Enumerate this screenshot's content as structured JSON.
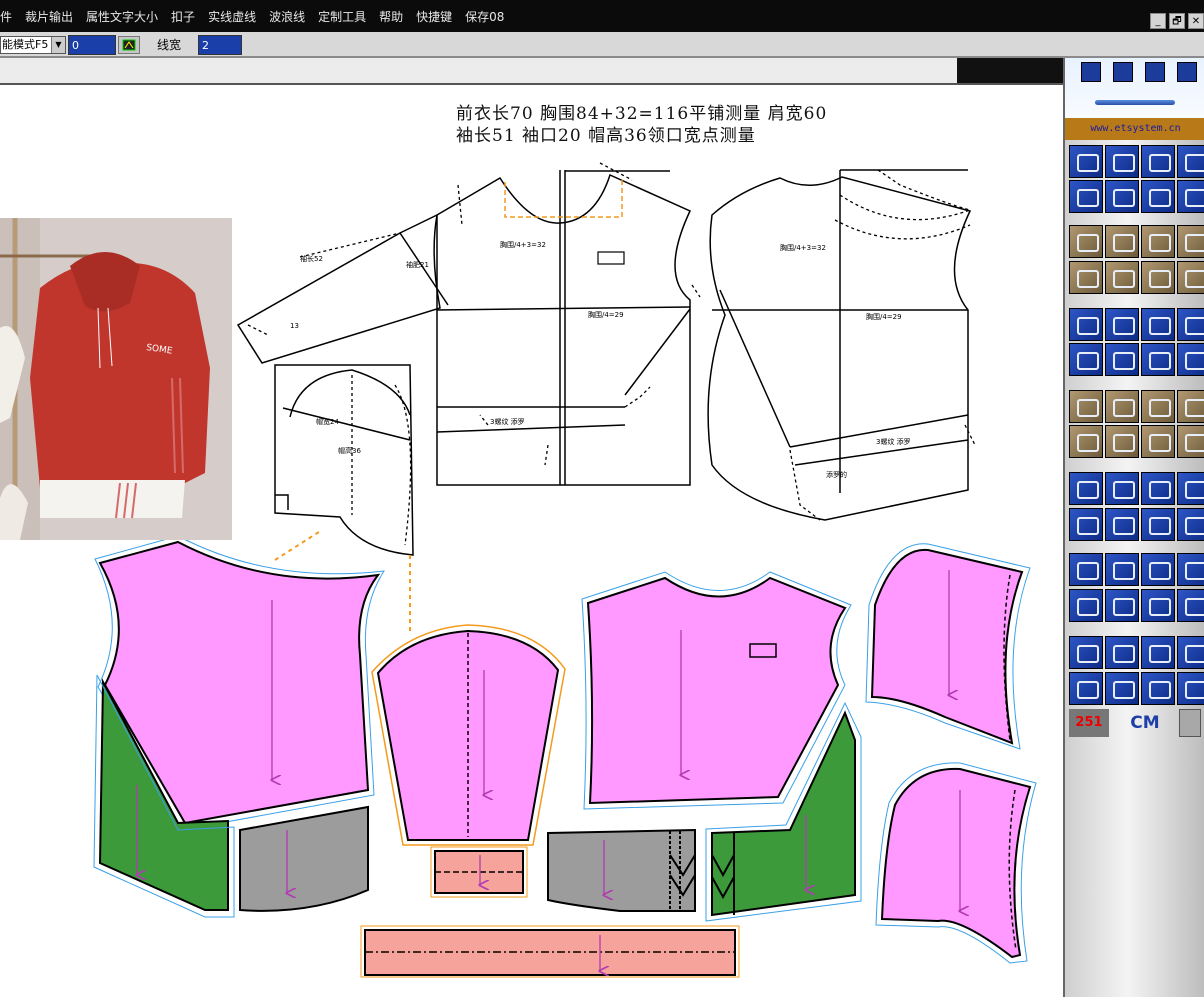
{
  "menubar": {
    "items": [
      "文件",
      "裁片输出",
      "属性文字大小",
      "扣子",
      "实线虚线",
      "波浪线",
      "定制工具",
      "帮助",
      "快捷键",
      "保存08"
    ],
    "window_buttons": [
      "_",
      "🗗",
      "✕"
    ]
  },
  "toolbar": {
    "mode_value": "能模式F5",
    "field1_value": "0",
    "linewidth_label": "线宽",
    "linewidth_value": "2"
  },
  "pattern": {
    "line1": "前衣长70  胸围84+32=116平铺测量  肩宽60",
    "line2": "袖长51  袖口20  帽高36领口宽点测量"
  },
  "right_panel": {
    "logo_url": "www.etsystem.cn",
    "count": "251",
    "unit": "CM"
  },
  "colors": {
    "pink": "#ff99ff",
    "salmon": "#f6a39b",
    "green": "#3d9a3a",
    "gray": "#9c9c9c",
    "orange": "#f49a1e",
    "seam_blue": "#3aa0e8",
    "grain": "#b23bb2",
    "panel_blue": "#1b3c9a"
  }
}
